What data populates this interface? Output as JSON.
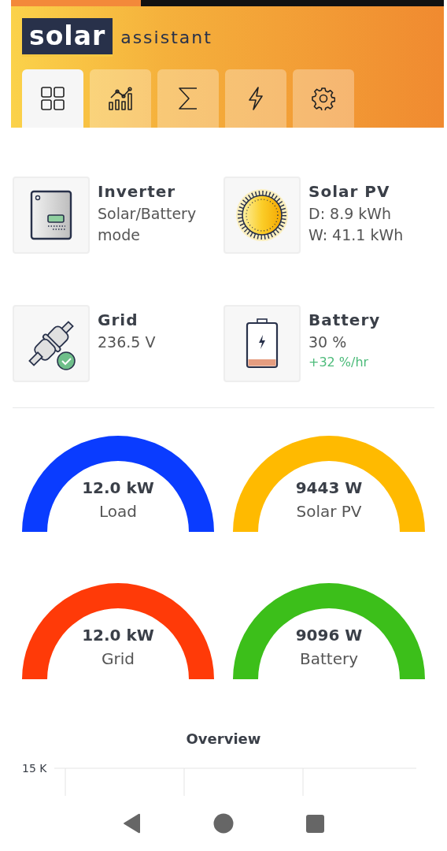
{
  "loading_bar": {
    "level": 0.3
  },
  "logo": {
    "word_boxed": "solar",
    "word_plain": "assistant"
  },
  "tabs": [
    {
      "kind": "grid",
      "selected": true
    },
    {
      "kind": "chart",
      "selected": false
    },
    {
      "kind": "sigma",
      "selected": false
    },
    {
      "kind": "bolt",
      "selected": false
    },
    {
      "kind": "gear",
      "selected": false
    }
  ],
  "status_cards": [
    {
      "kind": "inverter",
      "title": "Inverter",
      "lines": [
        "Solar/Battery mode"
      ]
    },
    {
      "kind": "sun",
      "title": "Solar PV",
      "lines": [
        "D: 8.9 kWh",
        "W: 41.1 kWh"
      ]
    },
    {
      "kind": "plug",
      "title": "Grid",
      "lines": [
        "236.5 V"
      ]
    },
    {
      "kind": "battery",
      "title": "Battery",
      "lines": [
        "30 %"
      ],
      "rate": "+32 %/hr"
    }
  ],
  "gauges": [
    {
      "value": "12.0 kW",
      "label": "Load",
      "color": "#0a3cff"
    },
    {
      "value": "9443 W",
      "label": "Solar PV",
      "color": "#ffba00"
    },
    {
      "value": "12.0 kW",
      "label": "Grid",
      "color": "#ff3a08"
    },
    {
      "value": "9096 W",
      "label": "Battery",
      "color": "#3cbf1a"
    }
  ],
  "chart": {
    "title": "Overview",
    "y_tick": "15 K"
  }
}
